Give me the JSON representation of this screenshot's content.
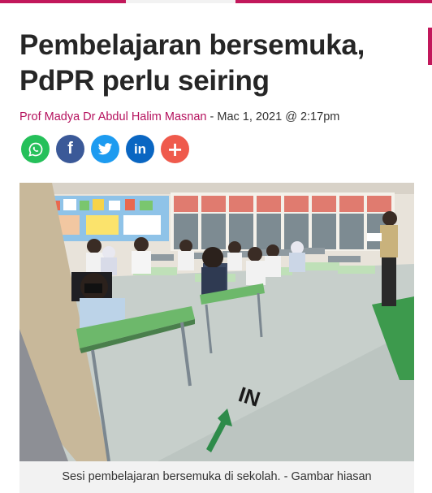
{
  "article": {
    "title": "Pembelajaran bersemuka, PdPR perlu seiring",
    "author": "Prof Madya Dr Abdul Halim Masnan",
    "date_separator": " - ",
    "date": "Mac 1, 2021 @ 2:17pm"
  },
  "share": [
    {
      "name": "whatsapp-icon",
      "color": "#25c05a",
      "glyph": ""
    },
    {
      "name": "facebook-icon",
      "color": "#3b5998",
      "glyph": "f"
    },
    {
      "name": "twitter-icon",
      "color": "#1d9bf0",
      "glyph": ""
    },
    {
      "name": "linkedin-icon",
      "color": "#0a66c2",
      "glyph": "in"
    },
    {
      "name": "more-share-icon",
      "color": "#ef5a4c",
      "glyph": "+"
    }
  ],
  "photo": {
    "floor_sign_text": "IN",
    "caption": "Sesi pembelajaran bersemuka di sekolah. - Gambar hiasan"
  },
  "colors": {
    "accent": "#c2185b",
    "author_link": "#b5125e"
  }
}
